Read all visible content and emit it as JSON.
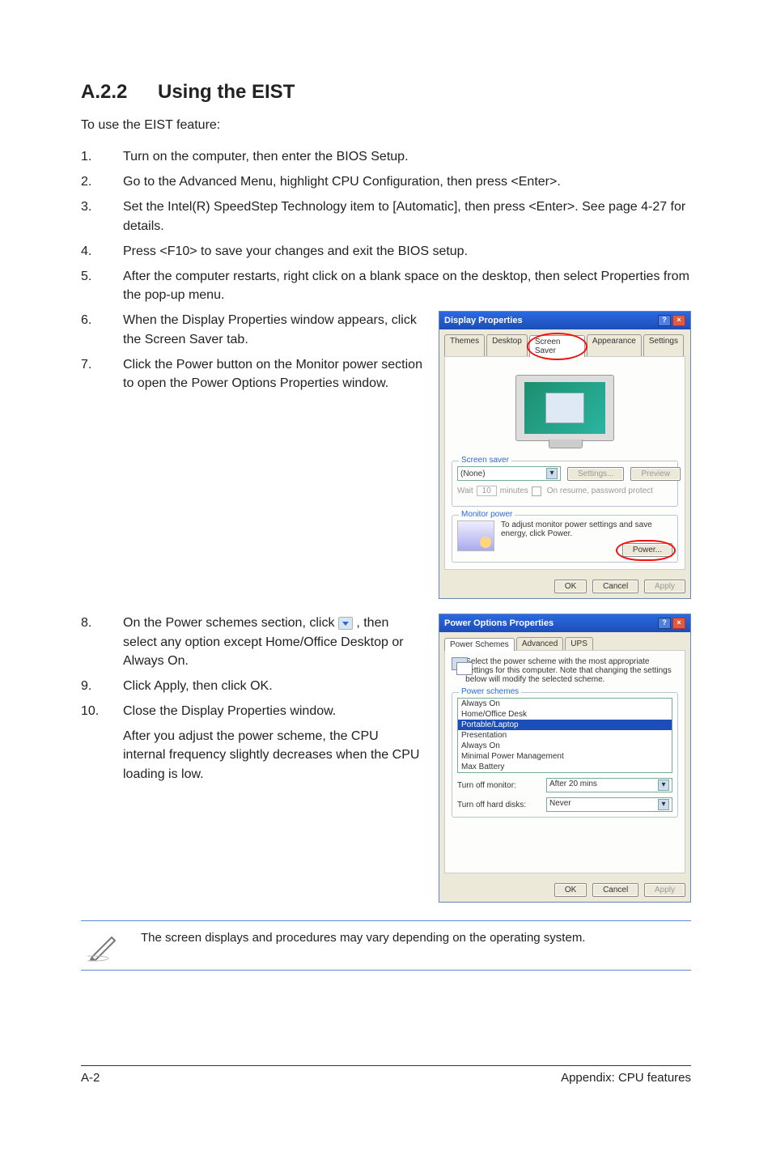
{
  "section": {
    "number": "A.2.2",
    "title": "Using the EIST"
  },
  "intro": "To use the EIST feature:",
  "steps": [
    "Turn on the computer, then enter the BIOS Setup.",
    "Go to the Advanced Menu, highlight CPU Configuration, then press <Enter>.",
    "Set the Intel(R) SpeedStep Technology item to [Automatic], then press <Enter>. See page 4-27 for details.",
    "Press <F10> to save your changes and exit the BIOS setup.",
    "After the computer restarts, right click on a blank space on the desktop, then select Properties from the pop-up menu.",
    "When the Display Properties window appears, click the Screen Saver tab.",
    "Click the Power button on the Monitor power section to open the Power Options Properties window."
  ],
  "steps2": [
    {
      "n": "8.",
      "t_a": "On the Power schemes section, click ",
      "t_b": " , then select any option except Home/Office Desktop or Always On."
    },
    {
      "n": "9.",
      "t_a": "Click Apply, then click OK.",
      "t_b": ""
    },
    {
      "n": "10.",
      "t_a": "Close the Display Properties window.",
      "t_b": ""
    }
  ],
  "after_text": "After you adjust the power scheme, the CPU internal frequency slightly decreases when the CPU loading is low.",
  "note": "The screen displays and procedures may vary depending on the operating system.",
  "footer": {
    "left": "A-2",
    "right": "Appendix: CPU features"
  },
  "display_props": {
    "title": "Display Properties",
    "tabs": [
      "Themes",
      "Desktop",
      "Screen Saver",
      "Appearance",
      "Settings"
    ],
    "screensaver": {
      "legend": "Screen saver",
      "selected": "(None)",
      "settings_btn": "Settings...",
      "preview_btn": "Preview",
      "wait_label": "Wait",
      "wait_val": "10",
      "wait_unit": "minutes",
      "resume_chk": "On resume, password protect"
    },
    "monitorpower": {
      "legend": "Monitor power",
      "text": "To adjust monitor power settings and save energy, click Power.",
      "power_btn": "Power..."
    },
    "ok": "OK",
    "cancel": "Cancel",
    "apply": "Apply"
  },
  "power_opts": {
    "title": "Power Options Properties",
    "tabs": [
      "Power Schemes",
      "Advanced",
      "UPS"
    ],
    "desc": "Select the power scheme with the most appropriate settings for this computer. Note that changing the settings below will modify the selected scheme.",
    "ps_legend": "Power schemes",
    "ps_selected": "Always On",
    "ps_options": [
      "Home/Office Desk",
      "Portable/Laptop",
      "Presentation",
      "Always On",
      "Minimal Power Management",
      "Max Battery"
    ],
    "turn_monitor_label": "Turn off monitor:",
    "turn_monitor_val": "After 20 mins",
    "turn_disk_label": "Turn off hard disks:",
    "turn_disk_val": "Never",
    "ok": "OK",
    "cancel": "Cancel",
    "apply": "Apply"
  }
}
